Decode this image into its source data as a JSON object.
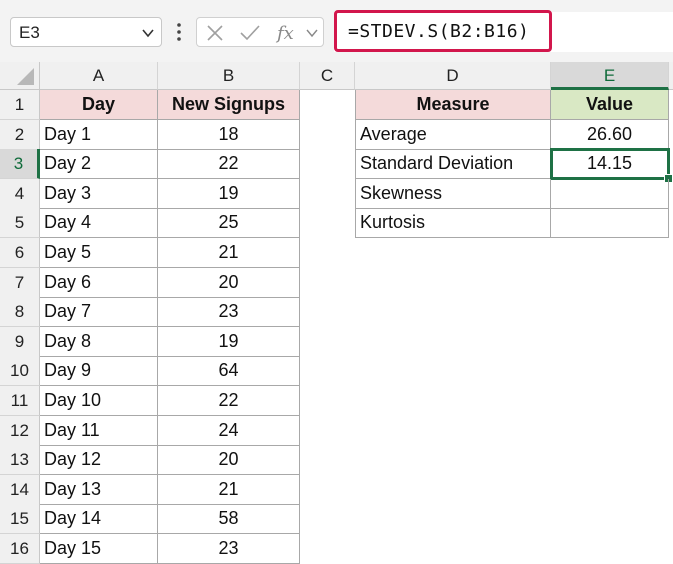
{
  "name_box": {
    "value": "E3"
  },
  "formula_bar": {
    "formula": "=STDEV.S(B2:B16)"
  },
  "columns": [
    "A",
    "B",
    "C",
    "D",
    "E"
  ],
  "rows": [
    "1",
    "2",
    "3",
    "4",
    "5",
    "6",
    "7",
    "8",
    "9",
    "10",
    "11",
    "12",
    "13",
    "14",
    "15",
    "16"
  ],
  "signups_table": {
    "headers": [
      "Day",
      "New Signups"
    ],
    "rows": [
      [
        "Day 1",
        "18"
      ],
      [
        "Day 2",
        "22"
      ],
      [
        "Day 3",
        "19"
      ],
      [
        "Day 4",
        "25"
      ],
      [
        "Day 5",
        "21"
      ],
      [
        "Day 6",
        "20"
      ],
      [
        "Day 7",
        "23"
      ],
      [
        "Day 8",
        "19"
      ],
      [
        "Day 9",
        "64"
      ],
      [
        "Day 10",
        "22"
      ],
      [
        "Day 11",
        "24"
      ],
      [
        "Day 12",
        "20"
      ],
      [
        "Day 13",
        "21"
      ],
      [
        "Day 14",
        "58"
      ],
      [
        "Day 15",
        "23"
      ]
    ]
  },
  "measures_table": {
    "headers": [
      "Measure",
      "Value"
    ],
    "rows": [
      [
        "Average",
        "26.60"
      ],
      [
        "Standard Deviation",
        "14.15"
      ],
      [
        "Skewness",
        ""
      ],
      [
        "Kurtosis",
        ""
      ]
    ]
  },
  "selected_cell": "E3",
  "colors": {
    "selection": "#1e7145",
    "formula_highlight": "#d2164c",
    "measure_header": "#f4dada",
    "value_header": "#d9e8c4"
  }
}
